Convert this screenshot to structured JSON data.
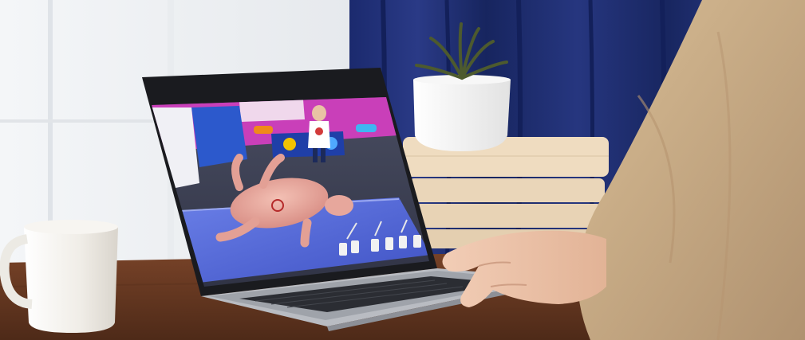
{
  "scene": {
    "subject": "laptop-on-desk-showing-3d-virtual-dissection-app",
    "objects": [
      "mug",
      "laptop",
      "plant-pot",
      "stacked-books",
      "person-hand",
      "curtain",
      "window"
    ],
    "colors": {
      "curtain": "#1f2f7a",
      "desk": "#6a3a22",
      "sweater": "#c9ad86",
      "mug": "#f1eee8",
      "books": "#ecd9bd",
      "lab_floor": "#5b6fd6",
      "lab_wall": "#cf3fbf",
      "lab_panel": "#2f5bd0",
      "specimen": "#e8a39a"
    }
  }
}
